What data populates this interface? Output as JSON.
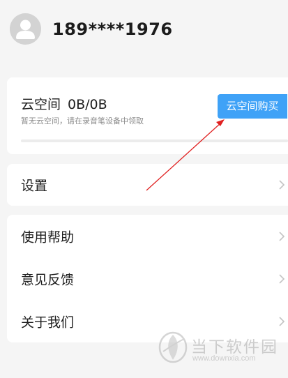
{
  "profile": {
    "phone": "189****1976"
  },
  "cloud": {
    "title": "云空间",
    "usage": "0B/0B",
    "subtitle": "暂无云空间，请在录音笔设备中领取",
    "buy_button": "云空间购买",
    "progress_percent": 0
  },
  "settings": {
    "label": "设置"
  },
  "menu": {
    "items": [
      {
        "label": "使用帮助"
      },
      {
        "label": "意见反馈"
      },
      {
        "label": "关于我们"
      }
    ]
  },
  "watermark": {
    "name": "当下软件园",
    "url": "www.downxia.com"
  },
  "colors": {
    "accent": "#3fa2f7",
    "annotation": "#e02020",
    "background": "#f5f5f5"
  }
}
